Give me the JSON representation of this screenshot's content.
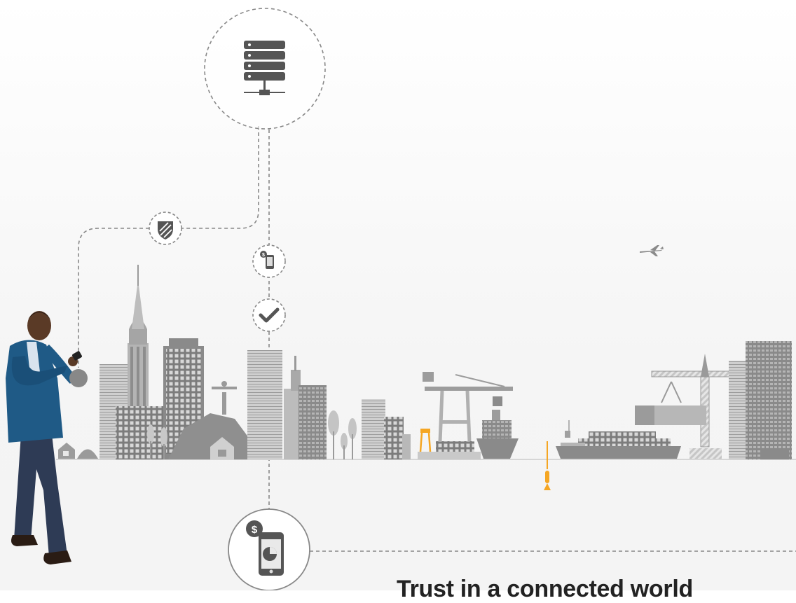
{
  "hero": {
    "headline": "Trust in a connected world"
  },
  "icons": {
    "server": "server-icon",
    "shield": "shield-icon",
    "mobile_payment": "mobile-payment-icon",
    "checkmark": "checkmark-icon",
    "mobile_analytics": "mobile-analytics-icon",
    "airplane": "airplane-icon"
  },
  "colors": {
    "connector_line": "#888888",
    "icon_fill": "#555555",
    "accent": "#f5a623",
    "skyline_dark": "#7a7a7a",
    "skyline_light": "#bdbdbd"
  }
}
